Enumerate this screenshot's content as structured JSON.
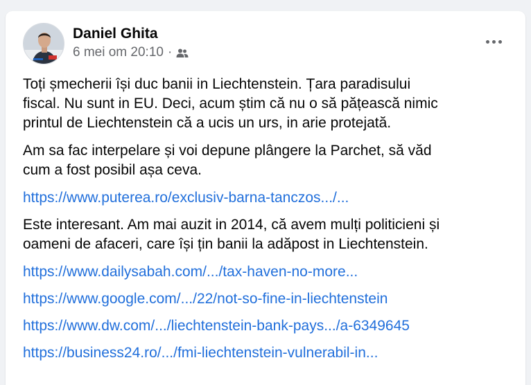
{
  "post": {
    "author": "Daniel Ghita",
    "timestamp": "6 mei om 20:10",
    "separator": "·",
    "audience_icon": "friends-icon",
    "more_icon": "more-horizontal-icon",
    "paragraphs": [
      [
        "Toți șmecherii își duc banii in Liechtenstein. Țara paradisului",
        "fiscal. Nu sunt in EU. Deci, acum știm că nu o să pățească nimic",
        "printul de Liechtenstein că a ucis un urs, in arie protejată."
      ],
      [
        "Am sa fac interpelare și voi depune plângere la Parchet, să văd",
        "cum a fost posibil așa ceva."
      ]
    ],
    "link1": "https://www.puterea.ro/exclusiv-barna-tanczos.../...",
    "paragraph3": [
      "Este interesant. Am mai auzit in 2014, că avem mulți politicieni și",
      "oameni de afaceri, care își țin banii la adăpost in Liechtenstein."
    ],
    "links": [
      "https://www.dailysabah.com/.../tax-haven-no-more...",
      "https://www.google.com/.../22/not-so-fine-in-liechtenstein",
      "https://www.dw.com/.../liechtenstein-bank-pays.../a-6349645",
      "https://business24.ro/.../fmi-liechtenstein-vulnerabil-in..."
    ]
  },
  "colors": {
    "link": "#216fdb",
    "text": "#050505",
    "secondary": "#65676b"
  }
}
